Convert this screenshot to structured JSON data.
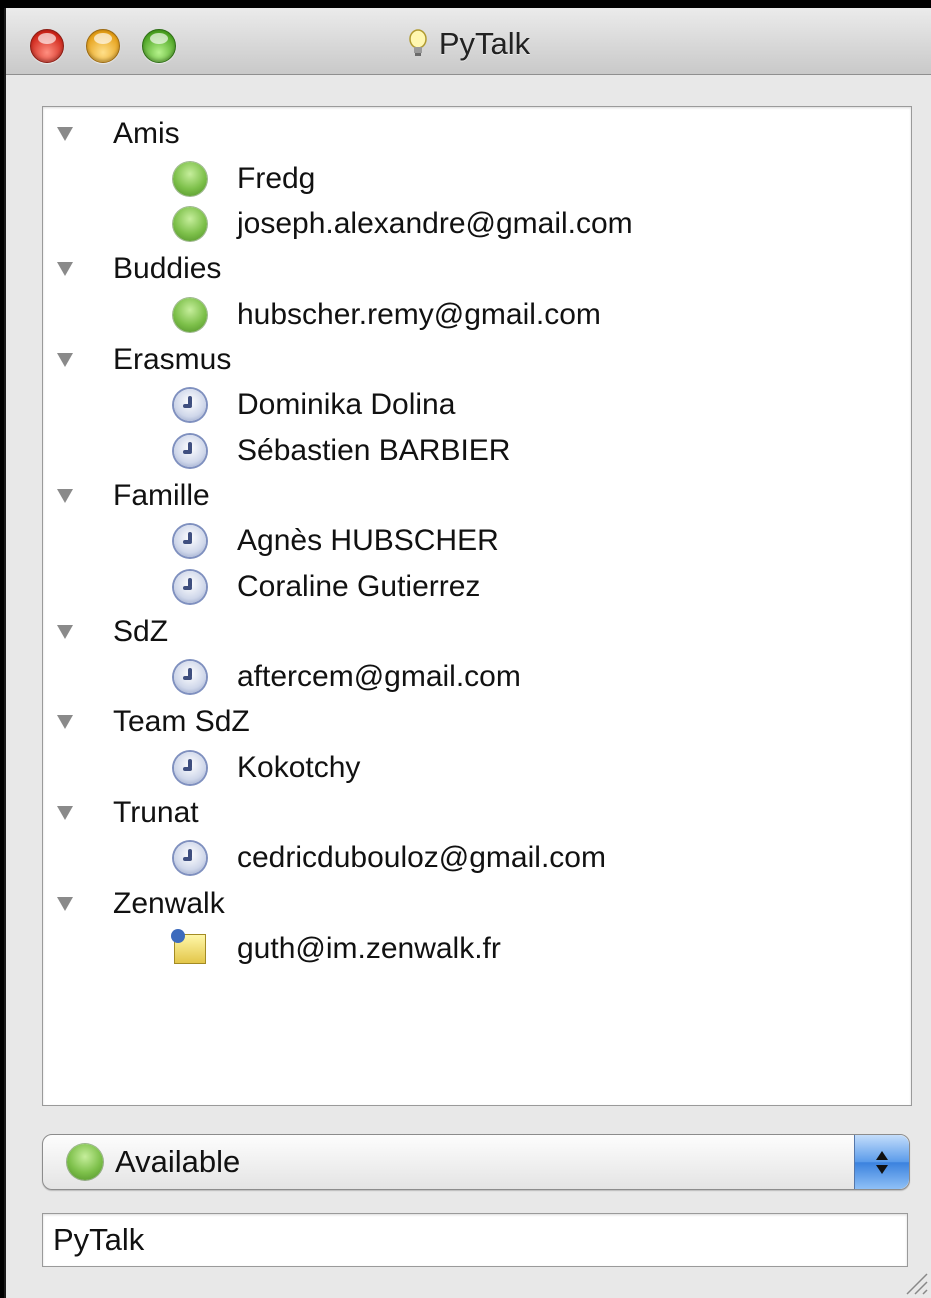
{
  "window": {
    "title": "PyTalk",
    "title_icon": "lightbulb-icon"
  },
  "roster": {
    "groups": [
      {
        "name": "Amis",
        "contacts": [
          {
            "name": "Fredg",
            "status": "available"
          },
          {
            "name": "joseph.alexandre@gmail.com",
            "status": "available"
          }
        ]
      },
      {
        "name": "Buddies",
        "contacts": [
          {
            "name": "hubscher.remy@gmail.com",
            "status": "available"
          }
        ]
      },
      {
        "name": "Erasmus",
        "contacts": [
          {
            "name": "Dominika Dolina",
            "status": "away"
          },
          {
            "name": "Sébastien BARBIER",
            "status": "away"
          }
        ]
      },
      {
        "name": "Famille",
        "contacts": [
          {
            "name": "Agnès HUBSCHER",
            "status": "away"
          },
          {
            "name": "Coraline Gutierrez",
            "status": "away"
          }
        ]
      },
      {
        "name": "SdZ",
        "contacts": [
          {
            "name": "aftercem@gmail.com",
            "status": "away"
          }
        ]
      },
      {
        "name": "Team SdZ",
        "contacts": [
          {
            "name": "Kokotchy",
            "status": "away"
          }
        ]
      },
      {
        "name": "Trunat",
        "contacts": [
          {
            "name": "cedricdubouloz@gmail.com",
            "status": "away"
          }
        ]
      },
      {
        "name": "Zenwalk",
        "contacts": [
          {
            "name": "guth@im.zenwalk.fr",
            "status": "pending"
          }
        ]
      }
    ]
  },
  "status_select": {
    "value": "Available",
    "icon": "green-status-dot-icon"
  },
  "status_message": {
    "value": "PyTalk"
  },
  "colors": {
    "available": "#7dc04a",
    "away": "#8797c0",
    "stepper": "#3b82de"
  }
}
